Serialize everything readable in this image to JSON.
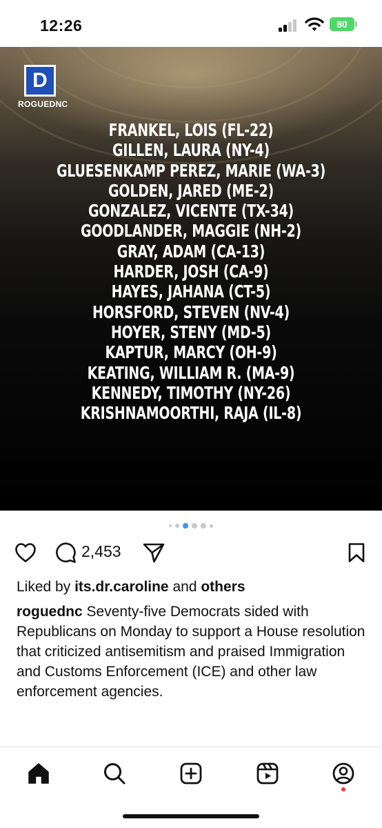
{
  "status_bar": {
    "time": "12:26",
    "battery": "80",
    "icons": [
      "cellular-signal-icon",
      "wifi-icon",
      "battery-charging-icon"
    ]
  },
  "post": {
    "logo": {
      "letter": "D",
      "name": "ROGUEDNC",
      "color": "#1f4fb8"
    },
    "names": [
      "FRANKEL, LOIS (FL-22)",
      "GILLEN, LAURA (NY-4)",
      "GLUESENKAMP PEREZ, MARIE (WA-3)",
      "GOLDEN, JARED (ME-2)",
      "GONZALEZ, VICENTE (TX-34)",
      "GOODLANDER, MAGGIE (NH-2)",
      "GRAY, ADAM (CA-13)",
      "HARDER, JOSH (CA-9)",
      "HAYES, JAHANA (CT-5)",
      "HORSFORD, STEVEN (NV-4)",
      "HOYER, STENY (MD-5)",
      "KAPTUR, MARCY (OH-9)",
      "KEATING, WILLIAM R. (MA-9)",
      "KENNEDY, TIMOTHY (NY-26)",
      "KRISHNAMOORTHI, RAJA (IL-8)"
    ],
    "carousel": {
      "active_index": 2,
      "count": 6,
      "accent": "#3897f0"
    }
  },
  "actions": {
    "comment_count": "2,453",
    "icons": [
      "heart-icon",
      "comment-icon",
      "share-icon",
      "bookmark-icon"
    ]
  },
  "likes": {
    "prefix": "Liked by ",
    "user": "its.dr.caroline",
    "joiner": " and ",
    "suffix": "others"
  },
  "caption": {
    "username": "roguednc",
    "text": " Seventy-five Democrats sided with Republicans on Monday to support a House resolution that criticized antisemitism and praised Immigration and Customs Enforcement (ICE) and other law enforcement agencies."
  },
  "bottom_nav": {
    "items": [
      "home-icon",
      "search-icon",
      "create-icon",
      "reels-icon",
      "profile-icon"
    ],
    "notification_color": "#ff3040"
  }
}
